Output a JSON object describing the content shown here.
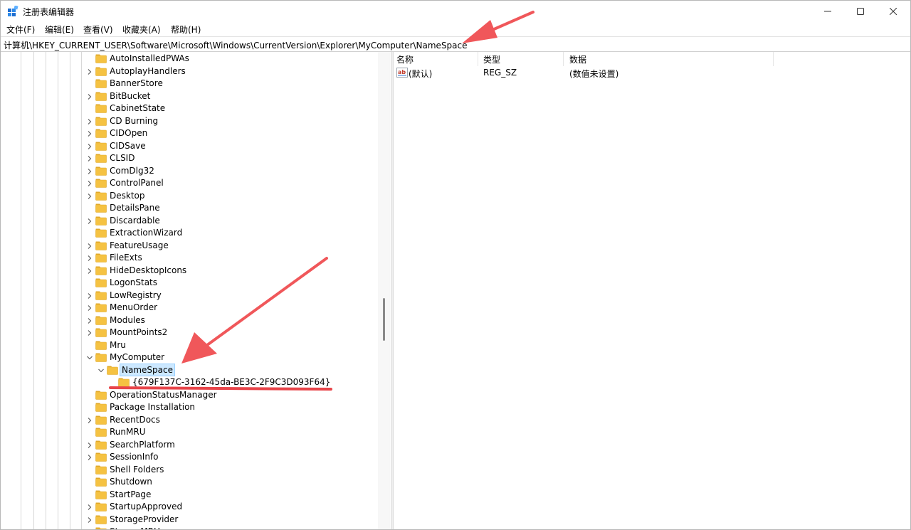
{
  "window": {
    "title": "注册表编辑器",
    "controls": {
      "minimize": "minimize-icon",
      "maximize": "maximize-icon",
      "close": "close-icon"
    }
  },
  "menubar": {
    "items": [
      "文件(F)",
      "编辑(E)",
      "查看(V)",
      "收藏夹(A)",
      "帮助(H)"
    ]
  },
  "address": {
    "path": "计算机\\HKEY_CURRENT_USER\\Software\\Microsoft\\Windows\\CurrentVersion\\Explorer\\MyComputer\\NameSpace"
  },
  "tree": {
    "nodes": [
      {
        "label": "AutoInstalledPWAs",
        "expander": "none"
      },
      {
        "label": "AutoplayHandlers",
        "expander": "collapsed"
      },
      {
        "label": "BannerStore",
        "expander": "none"
      },
      {
        "label": "BitBucket",
        "expander": "collapsed"
      },
      {
        "label": "CabinetState",
        "expander": "none"
      },
      {
        "label": "CD Burning",
        "expander": "collapsed"
      },
      {
        "label": "CIDOpen",
        "expander": "collapsed"
      },
      {
        "label": "CIDSave",
        "expander": "collapsed"
      },
      {
        "label": "CLSID",
        "expander": "collapsed"
      },
      {
        "label": "ComDlg32",
        "expander": "collapsed"
      },
      {
        "label": "ControlPanel",
        "expander": "collapsed"
      },
      {
        "label": "Desktop",
        "expander": "collapsed"
      },
      {
        "label": "DetailsPane",
        "expander": "none"
      },
      {
        "label": "Discardable",
        "expander": "collapsed"
      },
      {
        "label": "ExtractionWizard",
        "expander": "none"
      },
      {
        "label": "FeatureUsage",
        "expander": "collapsed"
      },
      {
        "label": "FileExts",
        "expander": "collapsed"
      },
      {
        "label": "HideDesktopIcons",
        "expander": "collapsed"
      },
      {
        "label": "LogonStats",
        "expander": "none"
      },
      {
        "label": "LowRegistry",
        "expander": "collapsed"
      },
      {
        "label": "MenuOrder",
        "expander": "collapsed"
      },
      {
        "label": "Modules",
        "expander": "collapsed"
      },
      {
        "label": "MountPoints2",
        "expander": "collapsed"
      },
      {
        "label": "Mru",
        "expander": "none"
      },
      {
        "label": "MyComputer",
        "expander": "expanded"
      },
      {
        "label": "NameSpace",
        "expander": "expanded",
        "level": 1,
        "selected": true
      },
      {
        "label": "{679F137C-3162-45da-BE3C-2F9C3D093F64}",
        "expander": "none",
        "level": 2
      },
      {
        "label": "OperationStatusManager",
        "expander": "none"
      },
      {
        "label": "Package Installation",
        "expander": "none"
      },
      {
        "label": "RecentDocs",
        "expander": "collapsed"
      },
      {
        "label": "RunMRU",
        "expander": "none"
      },
      {
        "label": "SearchPlatform",
        "expander": "collapsed"
      },
      {
        "label": "SessionInfo",
        "expander": "collapsed"
      },
      {
        "label": "Shell Folders",
        "expander": "none"
      },
      {
        "label": "Shutdown",
        "expander": "none"
      },
      {
        "label": "StartPage",
        "expander": "none"
      },
      {
        "label": "StartupApproved",
        "expander": "collapsed"
      },
      {
        "label": "StorageProvider",
        "expander": "collapsed"
      },
      {
        "label": "StreamMRU",
        "expander": "none"
      }
    ]
  },
  "list": {
    "columns": [
      "名称",
      "类型",
      "数据"
    ],
    "rows": [
      {
        "name": "(默认)",
        "type": "REG_SZ",
        "data": "(数值未设置)",
        "icon": "string-value-icon"
      }
    ]
  },
  "annotations": {
    "arrow_color": "#f0575a",
    "underline_color": "#e8454a"
  },
  "colors": {
    "folder": "#f5c242",
    "folder_dark": "#e0a82a",
    "selection_bg": "#cce8ff",
    "selection_border": "#99d1ff"
  }
}
